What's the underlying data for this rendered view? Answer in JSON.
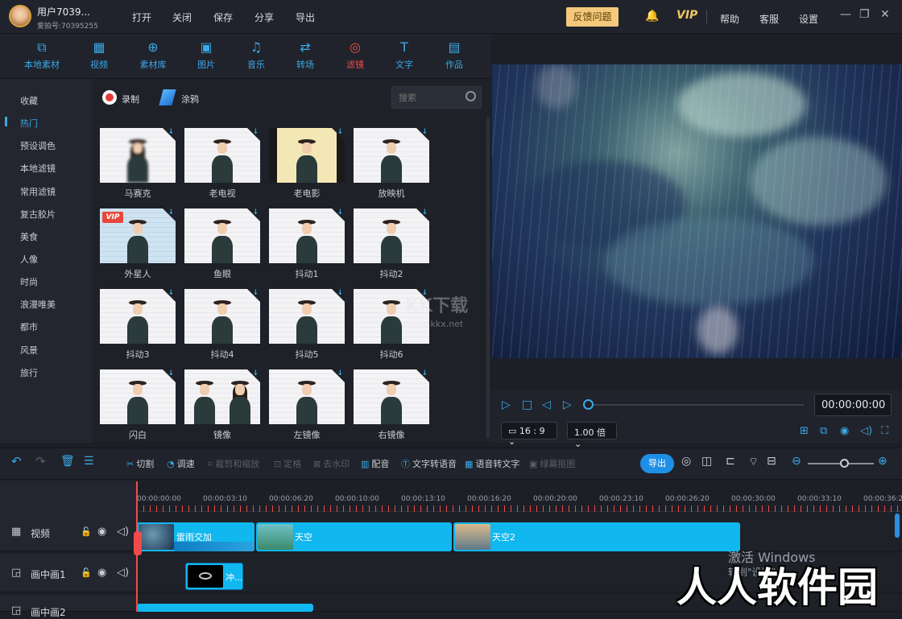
{
  "titlebar": {
    "username": "用户7039...",
    "user_id": "爱拍号:70395255",
    "menu": [
      "打开",
      "关闭",
      "保存",
      "分享",
      "导出"
    ],
    "feedback": "反馈问题",
    "vip": "VIP",
    "right_menu": [
      "帮助",
      "客服",
      "设置"
    ]
  },
  "toolbar": {
    "items": [
      {
        "label": "本地素材",
        "icon": "box-icon"
      },
      {
        "label": "视频",
        "icon": "film-icon"
      },
      {
        "label": "素材库",
        "icon": "library-icon"
      },
      {
        "label": "图片",
        "icon": "image-icon"
      },
      {
        "label": "音乐",
        "icon": "music-icon"
      },
      {
        "label": "转场",
        "icon": "transition-icon"
      },
      {
        "label": "滤镜",
        "icon": "filter-icon"
      },
      {
        "label": "文字",
        "icon": "text-icon"
      },
      {
        "label": "作品",
        "icon": "works-icon"
      }
    ],
    "active_index": 6
  },
  "sidebar": {
    "categories": [
      "收藏",
      "热门",
      "预设调色",
      "本地滤镜",
      "常用滤镜",
      "复古胶片",
      "美食",
      "人像",
      "时尚",
      "浪漫唯美",
      "都市",
      "风景",
      "旅行"
    ],
    "active_index": 1
  },
  "panel": {
    "record_label": "录制",
    "brush_label": "涂鸦",
    "search_placeholder": "搜索",
    "filters": [
      {
        "name": "马赛克"
      },
      {
        "name": "老电视"
      },
      {
        "name": "老电影"
      },
      {
        "name": "放映机"
      },
      {
        "name": "外星人",
        "vip": "VIP"
      },
      {
        "name": "鱼眼"
      },
      {
        "name": "抖动1"
      },
      {
        "name": "抖动2"
      },
      {
        "name": "抖动3"
      },
      {
        "name": "抖动4"
      },
      {
        "name": "抖动5"
      },
      {
        "name": "抖动6"
      },
      {
        "name": "闪白"
      },
      {
        "name": "镜像"
      },
      {
        "name": "左镜像"
      },
      {
        "name": "右镜像"
      }
    ]
  },
  "preview": {
    "timecode": "00:00:00:00",
    "aspect": "16 : 9",
    "speed": "1.00 倍",
    "watermark_site": "www.kkx.net",
    "watermark_logo": "KK下载"
  },
  "editbar": {
    "cut": "切割",
    "speed": "调速",
    "crop": "裁剪和缩放",
    "freeze": "定格",
    "remove_watermark": "去水印",
    "dub": "配音",
    "tts": "文字转语音",
    "stt": "语音转文字",
    "matting": "绿幕抠图",
    "export": "导出"
  },
  "timeline": {
    "ticks": [
      "00:00:00:00",
      "00:00:03:10",
      "00:00:06:20",
      "00:00:10:00",
      "00:00:13:10",
      "00:00:16:20",
      "00:00:20:00",
      "00:00:23:10",
      "00:00:26:20",
      "00:00:30:00",
      "00:00:33:10",
      "00:00:36:20"
    ],
    "tracks": [
      {
        "name": "视频"
      },
      {
        "name": "画中画1"
      },
      {
        "name": "画中画2"
      }
    ],
    "video_clips": [
      "雷雨交加",
      "天空",
      "天空2"
    ],
    "pip_clip": "冲..."
  },
  "overlay": {
    "activate": "激活 Windows",
    "activate_sub": "转到\"设置\"",
    "site_watermark": "人人软件园"
  }
}
